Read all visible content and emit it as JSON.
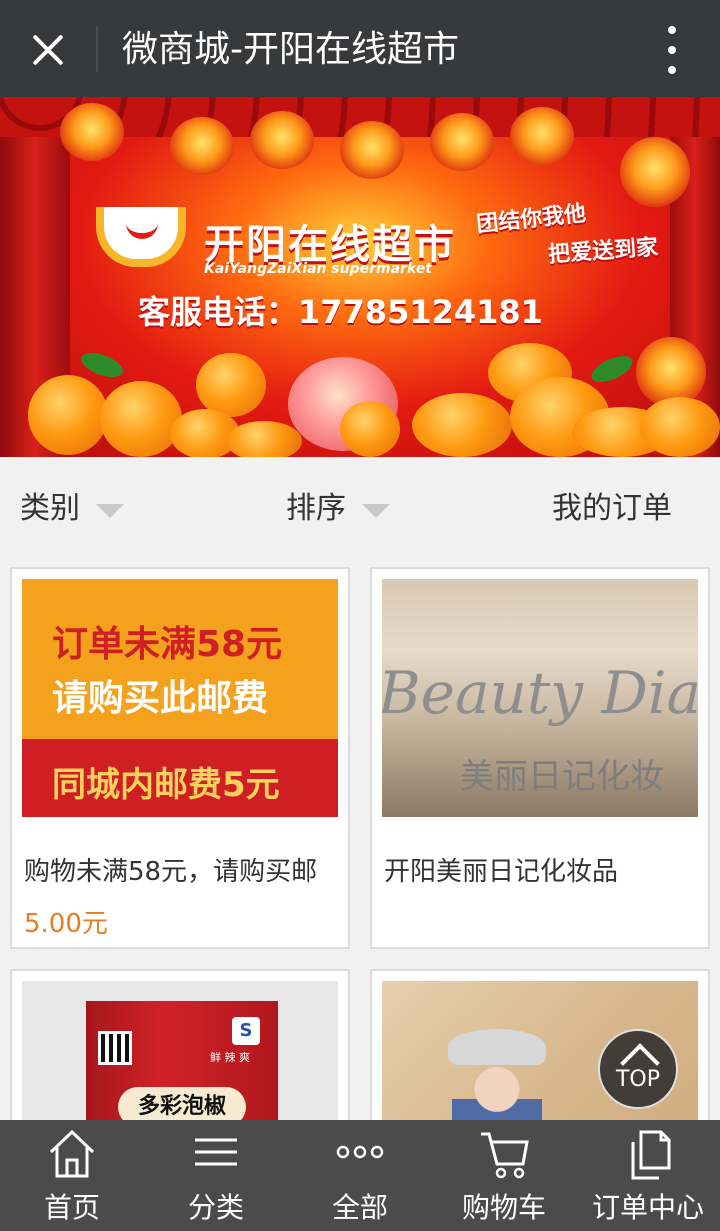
{
  "header": {
    "title": "微商城-开阳在线超市"
  },
  "banner": {
    "brand_cn": "开阳在线超市",
    "brand_en": "KaiYangZaiXian supermarket",
    "slogan_1": "团结你我他",
    "slogan_2": "把爱送到家",
    "phone": "客服电话：17785124181"
  },
  "filters": {
    "category": "类别",
    "sort": "排序",
    "my_orders": "我的订单"
  },
  "products": [
    {
      "name": "购物未满58元，请购买邮",
      "price": "5.00元",
      "image_text": [
        "订单未满58元",
        "请购买此邮费",
        "同城内邮费5元"
      ]
    },
    {
      "name": "开阳美丽日记化妆品",
      "price": "",
      "image_text": [
        "Beauty Diar",
        "美丽日记化妆"
      ]
    },
    {
      "name": "",
      "price": "",
      "image_text": [
        "多彩泡椒",
        "鲜 辣 爽"
      ]
    },
    {
      "name": "",
      "price": "",
      "image_text": []
    }
  ],
  "top_button": {
    "label": "TOP"
  },
  "bottom_nav": [
    {
      "label": "首页",
      "icon": "home-icon"
    },
    {
      "label": "分类",
      "icon": "menu-icon"
    },
    {
      "label": "全部",
      "icon": "more-dots-icon"
    },
    {
      "label": "购物车",
      "icon": "cart-icon"
    },
    {
      "label": "订单中心",
      "icon": "document-icon"
    }
  ],
  "colors": {
    "header_bg": "#38393b",
    "price": "#e67e22",
    "bottom_nav_bg": "#4b4b4b"
  }
}
